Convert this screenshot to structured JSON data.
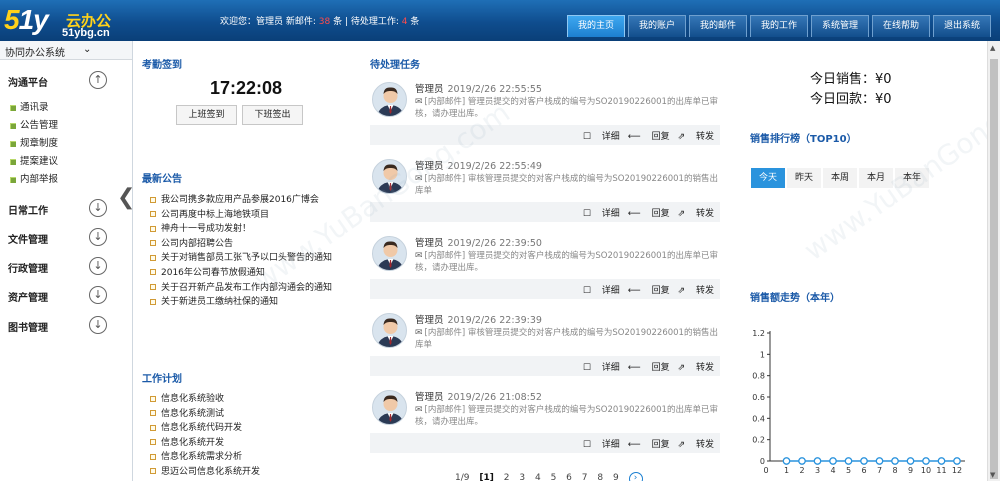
{
  "brand": {
    "logo_big": "51y",
    "logo_cn": "云办公",
    "logo_url": "51ybg.cn"
  },
  "header": {
    "welcome_prefix": "欢迎您：管理员 新邮件: ",
    "new_mail_count": "38",
    "mail_suffix": " 条 |  待处理工作: ",
    "pending_count": "4",
    "pending_suffix": " 条"
  },
  "tabs": [
    "我的主页",
    "我的账户",
    "我的邮件",
    "我的工作",
    "系统管理",
    "在线帮助",
    "退出系统"
  ],
  "sidebar": {
    "system": "协同办公系统",
    "caret": "⌄",
    "groups": [
      {
        "label": "沟通平台",
        "icon": "arrow-up-icon",
        "items": [
          "通讯录",
          "公告管理",
          "规章制度",
          "提案建议",
          "内部举报"
        ]
      },
      {
        "label": "日常工作",
        "icon": "arrow-down-icon"
      },
      {
        "label": "文件管理",
        "icon": "arrow-down-icon"
      },
      {
        "label": "行政管理",
        "icon": "arrow-down-icon"
      },
      {
        "label": "资产管理",
        "icon": "arrow-down-icon"
      },
      {
        "label": "图书管理",
        "icon": "arrow-down-icon"
      }
    ],
    "collapse": "❮"
  },
  "attendance": {
    "title": "考勤签到",
    "time": "17:22:08",
    "checkin": "上班签到",
    "checkout": "下班签出"
  },
  "announcements": {
    "title": "最新公告",
    "items": [
      "我公司携多款应用产品参展2016广博会",
      "公司再度中标上海地铁项目",
      "神舟十一号成功发射！",
      "公司内部招聘公告",
      "关于对销售部员工张飞予以口头警告的通知",
      "2016年公司春节放假通知",
      "关于召开新产品发布工作内部沟通会的通知",
      "关于新进员工缴纳社保的通知"
    ]
  },
  "work_plan": {
    "title": "工作计划",
    "items": [
      "信息化系统验收",
      "信息化系统测试",
      "信息化系统代码开发",
      "信息化系统开发",
      "信息化系统需求分析",
      "思迈公司信息化系统开发"
    ]
  },
  "tasks": {
    "title": "待处理任务",
    "actions": {
      "detail": "详细",
      "reply": "回复",
      "forward": "转发"
    },
    "items": [
      {
        "user": "管理员",
        "time": "2019/2/26 22:55:55",
        "text": "[内部邮件] 管理员提交的对客户栈成的编号为SO20190226001的出库单已审核，请办理出库。"
      },
      {
        "user": "管理员",
        "time": "2019/2/26 22:55:49",
        "text": "[内部邮件] 审核管理员提交的对客户栈成的编号为SO20190226001的销售出库单"
      },
      {
        "user": "管理员",
        "time": "2019/2/26 22:39:50",
        "text": "[内部邮件] 管理员提交的对客户栈成的编号为SO20190226001的出库单已审核，请办理出库。"
      },
      {
        "user": "管理员",
        "time": "2019/2/26 22:39:39",
        "text": "[内部邮件] 审核管理员提交的对客户栈成的编号为SO20190226001的销售出库单"
      },
      {
        "user": "管理员",
        "time": "2019/2/26 21:08:52",
        "text": "[内部邮件] 管理员提交的对客户栈成的编号为SO20190226001的出库单已审核，请办理出库。"
      }
    ],
    "pager": {
      "info": "1/9",
      "current": "[1]",
      "pages": [
        "2",
        "3",
        "4",
        "5",
        "6",
        "7",
        "8",
        "9"
      ]
    }
  },
  "sales": {
    "today_sales": "今日销售：¥0",
    "today_receipts": "今日回款：¥0",
    "rank_title": "销售排行榜（TOP10）",
    "rank_tabs": [
      "今天",
      "昨天",
      "本周",
      "本月",
      "本年"
    ],
    "trend_title": "销售额走势（本年）"
  },
  "chart_data": {
    "type": "line",
    "x": [
      1,
      2,
      3,
      4,
      5,
      6,
      7,
      8,
      9,
      10,
      11,
      12
    ],
    "series": [
      {
        "values": [
          0,
          0,
          0,
          0,
          0,
          0,
          0,
          0,
          0,
          0,
          0,
          0
        ]
      }
    ],
    "y_ticks": [
      "0",
      "0.2",
      "0.4",
      "0.6",
      "0.8",
      "1",
      "1.2"
    ],
    "ylim": [
      0,
      1.2
    ],
    "x_zero_label": "0",
    "color": "#2a93dd"
  },
  "colors": {
    "accent": "#1b5aa8",
    "header": "#0f4d8e",
    "active_tab": "#2a93dd"
  }
}
